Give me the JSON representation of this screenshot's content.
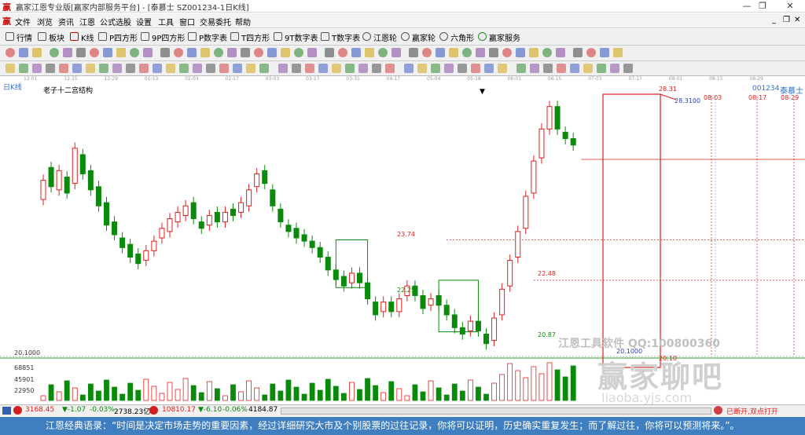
{
  "window": {
    "title": "赢家江恩专业版[赢家内部服务平台] - [泰慕士 SZ001234-1日K线]",
    "controls": [
      "—",
      "❐",
      "✕"
    ],
    "mdi_controls": [
      "_",
      "❐",
      "✕"
    ]
  },
  "menu": [
    "文件",
    "浏览",
    "资讯",
    "江恩",
    "公式选股",
    "设置",
    "工具",
    "窗口",
    "交易委托",
    "帮助"
  ],
  "toolbar1": [
    "行情",
    "板块",
    "K线",
    "P四方形",
    "9P四方形",
    "P数字表",
    "T四方形",
    "9T数字表",
    "T数字表",
    "江恩轮",
    "赢家轮",
    "六角形",
    "赢家服务"
  ],
  "date_scale": [
    "12-01",
    "12-15",
    "12-29",
    "01-13",
    "02-03",
    "02-17",
    "03-03",
    "03-17",
    "03-31",
    "04-17",
    "05-04",
    "05-18",
    "06-01",
    "06-15",
    "07-03",
    "07-17",
    "08-01",
    "08-15",
    "08-29"
  ],
  "chart": {
    "period_label": "日K线",
    "indicator_label": "老子十二宫结构",
    "stock_code": "001234",
    "stock_name": "泰慕士",
    "high_label": "28.31",
    "high_value_label": "28.3100",
    "top_right_dates": [
      "08-03",
      "08-17",
      "08-29"
    ],
    "low_left_label": "20.1000",
    "box_labels": {
      "upper1": "23.74",
      "lower1": "22.25",
      "upper2": "22.48",
      "lower2": "20.87"
    },
    "bottom_left_price": "20.1000",
    "bottom_right_price": "20.10",
    "watermark_text": "江恩工具软件  QQ:100800360",
    "watermark_brand": "赢家聊吧",
    "watermark_url": "liaoba.yjs.com"
  },
  "volume": {
    "axis_labels": [
      "68851",
      "45901",
      "22950"
    ]
  },
  "status": {
    "sh_index": "3168.45",
    "sh_change": "▼-1.07",
    "sh_pct": "-0.03%",
    "sh_amount": "2738.23亿",
    "sz_index": "10810.17",
    "sz_change": "▼-6.10",
    "sz_pct": "-0.06%",
    "sz_amount": "4184.87",
    "right_text": "已断开,双点打开"
  },
  "quote": "江恩经典语录：“时间是决定市场走势的重要因素，经过详细研究大市及个别股票的过往记录，你将可以证明，历史确实重复发生；而了解过往，你将可以预测将来。”。",
  "colors": {
    "up": "#e0201e",
    "down": "#0a8a0a",
    "accent": "#2f6fc9",
    "quote_bg": "#3f7fbf"
  },
  "chart_data": {
    "type": "candlestick",
    "x_range_days": [
      0,
      160
    ],
    "ylim": [
      20.1,
      28.31
    ],
    "price_data": [
      [
        0,
        25.0,
        25.6
      ],
      [
        2,
        26.0,
        25.4
      ],
      [
        4,
        25.3,
        25.9
      ],
      [
        6,
        25.7,
        25.2
      ],
      [
        8,
        25.5,
        26.6
      ],
      [
        10,
        26.4,
        25.8
      ],
      [
        12,
        25.9,
        25.3
      ],
      [
        14,
        25.4,
        24.8
      ],
      [
        16,
        24.9,
        24.2
      ],
      [
        18,
        24.3,
        23.9
      ],
      [
        20,
        23.8,
        23.5
      ],
      [
        22,
        23.6,
        23.2
      ],
      [
        24,
        23.3,
        23.0
      ],
      [
        26,
        23.1,
        23.4
      ],
      [
        28,
        23.4,
        23.7
      ],
      [
        30,
        23.8,
        24.1
      ],
      [
        32,
        24.0,
        24.4
      ],
      [
        34,
        24.3,
        24.6
      ],
      [
        36,
        24.5,
        24.8
      ],
      [
        38,
        24.9,
        24.4
      ],
      [
        40,
        24.3,
        24.1
      ],
      [
        42,
        24.2,
        24.5
      ],
      [
        44,
        24.6,
        24.3
      ],
      [
        46,
        24.3,
        24.6
      ],
      [
        48,
        24.7,
        24.5
      ],
      [
        50,
        24.6,
        24.9
      ],
      [
        52,
        24.8,
        25.3
      ],
      [
        54,
        25.4,
        25.8
      ],
      [
        56,
        25.9,
        25.5
      ],
      [
        58,
        25.3,
        24.8
      ],
      [
        60,
        24.7,
        24.3
      ],
      [
        62,
        24.2,
        24.0
      ],
      [
        64,
        24.1,
        23.8
      ],
      [
        66,
        23.9,
        23.7
      ],
      [
        68,
        23.7,
        23.5
      ],
      [
        70,
        23.5,
        23.2
      ],
      [
        72,
        23.2,
        22.8
      ],
      [
        74,
        22.8,
        22.5
      ],
      [
        76,
        22.6,
        22.3
      ],
      [
        78,
        22.4,
        22.7
      ],
      [
        80,
        22.7,
        22.4
      ],
      [
        82,
        22.4,
        21.9
      ],
      [
        84,
        21.8,
        21.4
      ],
      [
        86,
        21.5,
        21.8
      ],
      [
        88,
        21.8,
        21.5
      ],
      [
        90,
        21.5,
        21.9
      ],
      [
        92,
        22.0,
        22.3
      ],
      [
        94,
        22.3,
        22.0
      ],
      [
        96,
        22.0,
        21.6
      ],
      [
        98,
        21.7,
        21.9
      ],
      [
        100,
        22.0,
        21.7
      ],
      [
        102,
        21.7,
        21.4
      ],
      [
        104,
        21.4,
        21.0
      ],
      [
        106,
        21.0,
        20.8
      ],
      [
        108,
        20.9,
        21.2
      ],
      [
        110,
        21.2,
        20.9
      ],
      [
        112,
        20.8,
        20.5
      ],
      [
        114,
        20.6,
        21.3
      ],
      [
        116,
        21.4,
        22.2
      ],
      [
        118,
        22.3,
        23.1
      ],
      [
        120,
        23.2,
        24.0
      ],
      [
        122,
        24.1,
        25.1
      ],
      [
        124,
        25.2,
        26.2
      ],
      [
        126,
        26.3,
        27.2
      ],
      [
        128,
        27.2,
        27.9
      ],
      [
        130,
        27.9,
        27.2
      ],
      [
        132,
        27.1,
        26.9
      ],
      [
        134,
        26.9,
        26.7
      ]
    ]
  }
}
